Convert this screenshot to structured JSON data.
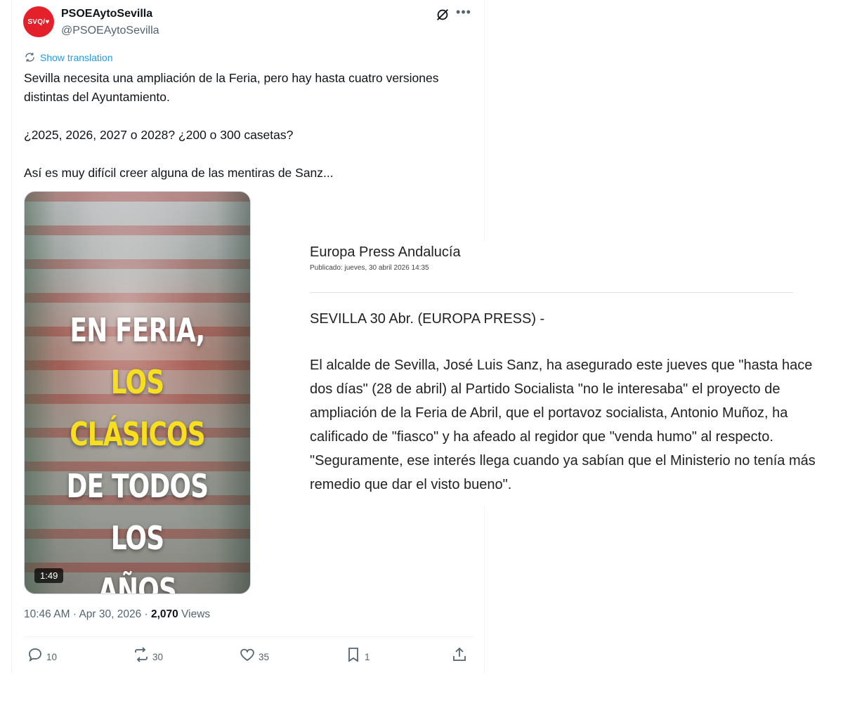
{
  "tweet": {
    "avatar_text": "SVQ/♥",
    "display_name": "PSOEAytoSevilla",
    "handle": "@PSOEAytoSevilla",
    "translate_label": "Show translation",
    "text_lines": [
      "Sevilla necesita una ampliación de la Feria, pero hay hasta cuatro versiones distintas del Ayuntamiento.",
      "¿2025, 2026, 2027 o 2028? ¿200 o 300 casetas?",
      "Así es muy difícil creer alguna de las mentiras de Sanz..."
    ],
    "video": {
      "overlay_line1": "EN FERIA,",
      "overlay_line2": "LOS CLÁSICOS",
      "overlay_line3": "DE TODOS LOS",
      "overlay_line4": "AÑOS",
      "duration": "1:49"
    },
    "time": "10:46 AM",
    "separator": "·",
    "date": "Apr 30, 2026",
    "views_count": "2,070",
    "views_label": "Views",
    "actions": {
      "replies": "10",
      "reposts": "30",
      "likes": "35",
      "bookmarks": "1"
    },
    "colors": {
      "accent": "#1d9bf0",
      "avatar_bg": "#e4202a",
      "overlay_yellow": "#f7de1e"
    }
  },
  "article": {
    "source": "Europa Press Andalucía",
    "published": "Publicado: jueves, 30 abril 2026 14:35",
    "dateline": "SEVILLA 30 Abr. (EUROPA PRESS) -",
    "body": "El alcalde de Sevilla, José Luis Sanz, ha asegurado este jueves que \"hasta hace dos días\" (28 de abril) al Partido Socialista \"no le interesaba\" el proyecto de ampliación de la Feria de Abril, que el portavoz socialista, Antonio Muñoz, ha calificado de \"fiasco\" y ha afeado al regidor que \"venda humo\" al respecto. \"Seguramente, ese interés llega cuando ya sabían que el Ministerio no tenía más remedio que dar el visto bueno\"."
  }
}
